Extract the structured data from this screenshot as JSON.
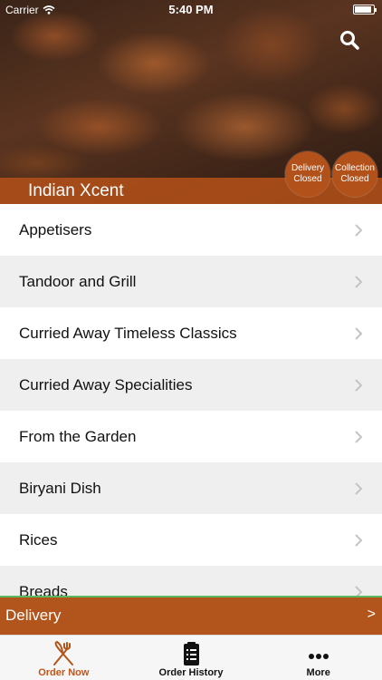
{
  "status_bar": {
    "carrier": "Carrier",
    "time": "5:40 PM"
  },
  "header": {
    "restaurant_name": "Indian Xcent",
    "delivery_status": [
      "Delivery",
      "Closed"
    ],
    "collection_status": [
      "Collection",
      "Closed"
    ]
  },
  "menu": {
    "items": [
      {
        "label": "Appetisers"
      },
      {
        "label": "Tandoor and Grill"
      },
      {
        "label": "Curried Away Timeless Classics"
      },
      {
        "label": "Curried Away Specialities"
      },
      {
        "label": "From the Garden"
      },
      {
        "label": "Biryani Dish"
      },
      {
        "label": "Rices"
      },
      {
        "label": "Breads"
      }
    ]
  },
  "delivery_bar": {
    "label": "Delivery",
    "arrow": ">"
  },
  "tabs": [
    {
      "label": "Order Now",
      "icon": "fork-knife-icon",
      "active": true
    },
    {
      "label": "Order History",
      "icon": "clipboard-icon",
      "active": false
    },
    {
      "label": "More",
      "icon": "more-dots-icon",
      "active": false
    }
  ],
  "colors": {
    "accent": "#b2551c",
    "active_tab": "#c0551a",
    "divider_green": "#5cb85c"
  }
}
